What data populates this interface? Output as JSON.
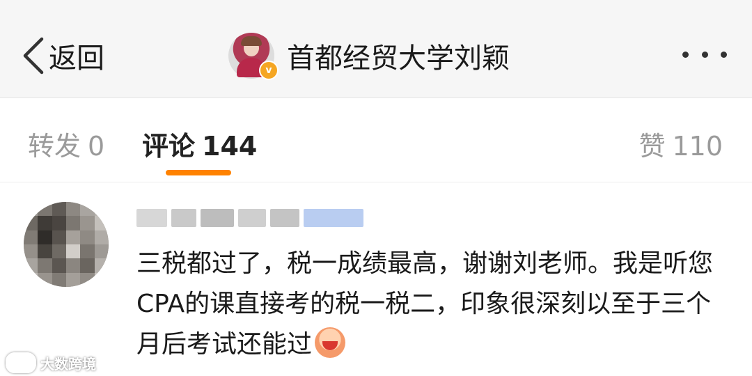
{
  "header": {
    "back_label": "返回",
    "title": "首都经贸大学刘颖",
    "verified_badge": "v"
  },
  "tabs": {
    "repost_label": "转发",
    "repost_count": "0",
    "comment_label": "评论",
    "comment_count": "144",
    "like_label": "赞",
    "like_count": "110",
    "active_indicator_color": "#ff8200"
  },
  "comment": {
    "text": "三税都过了，税一成绩最高，谢谢刘老师。我是听您CPA的课直接考的税一税二，印象很深刻以至于三个月后考试还能过",
    "emoji": "laughing-emoji-icon"
  },
  "watermark": {
    "text": "大数跨境"
  },
  "colors": {
    "header_bg": "#f6f6f6",
    "accent": "#ff8200",
    "verified": "#f5a623",
    "inactive_tab": "#9a9a9a"
  }
}
